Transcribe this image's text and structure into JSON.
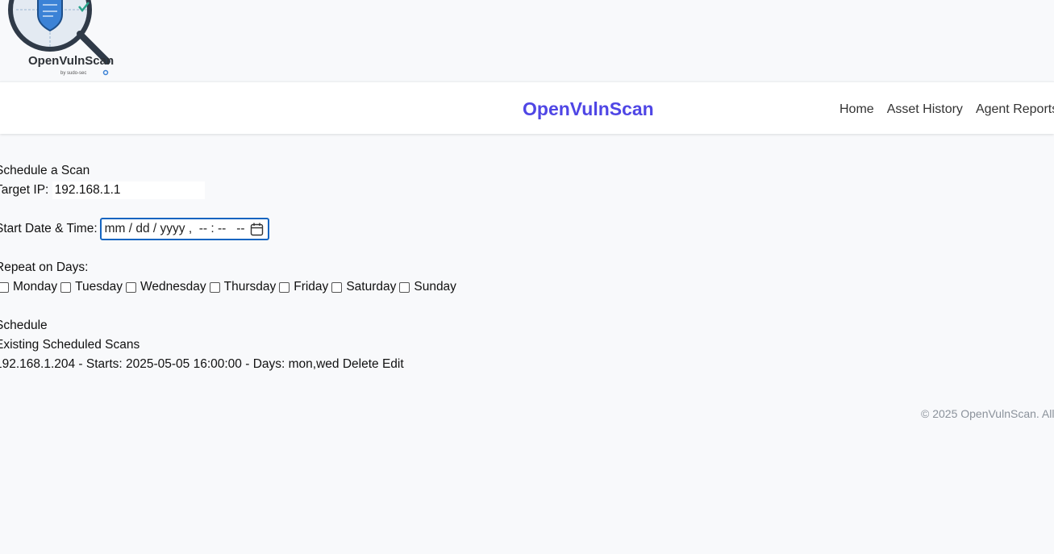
{
  "logo": {
    "text": "OpenVulnScan",
    "subtext": "by sudo-sec"
  },
  "navbar": {
    "brand": "OpenVulnScan",
    "links": [
      "Home",
      "Asset History",
      "Agent Reports"
    ]
  },
  "form": {
    "heading": "Schedule a Scan",
    "target_ip_label": "Target IP:",
    "target_ip_value": "192.168.1.1",
    "start_label": "Start Date & Time:",
    "start_placeholder": "mm / dd / yyyy ,  -- : --   --",
    "repeat_label": "Repeat on Days:",
    "days": [
      "Monday",
      "Tuesday",
      "Wednesday",
      "Thursday",
      "Friday",
      "Saturday",
      "Sunday"
    ],
    "submit_label": "Schedule"
  },
  "existing": {
    "heading": "Existing Scheduled Scans",
    "scans": [
      {
        "text": "192.168.1.204 - Starts: 2025-05-05 16:00:00 - Days: mon,wed",
        "delete_label": "Delete",
        "edit_label": "Edit"
      }
    ]
  },
  "footer": {
    "text": "© 2025 OpenVulnScan. All"
  },
  "colors": {
    "brand": "#4f46e5",
    "focus_border": "#1565c0",
    "background": "#f8f9fb"
  },
  "icons": [
    "shield-magnifier-logo-icon",
    "calendar-icon"
  ]
}
